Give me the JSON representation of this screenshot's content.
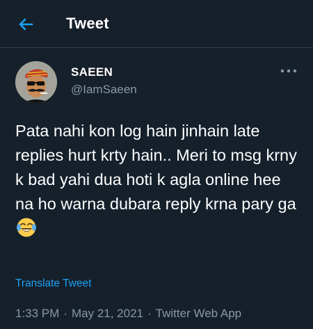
{
  "header": {
    "back_icon": "arrow-left-icon",
    "title": "Tweet"
  },
  "author": {
    "display_name": "SAEEN",
    "handle": "@IamSaeen",
    "avatar_icon": "cartoon-man-with-turban-sunglasses-avatar"
  },
  "more_icon": "more-horizontal-icon",
  "tweet": {
    "text": "Pata nahi kon log hain jinhain late replies hurt krty hain.. Meri to msg krny k bad yahi dua hoti k agla online hee na ho warna dubara reply krna pary ga",
    "emoji": "face-with-tears-of-joy-emoji",
    "translate_label": "Translate Tweet"
  },
  "meta": {
    "time": "1:33 PM",
    "separator": "·",
    "date": "May 21, 2021",
    "source": "Twitter Web App"
  },
  "colors": {
    "background": "#15202b",
    "accent": "#1da1f2",
    "secondary_text": "#8899a6",
    "divider": "#38444d"
  }
}
